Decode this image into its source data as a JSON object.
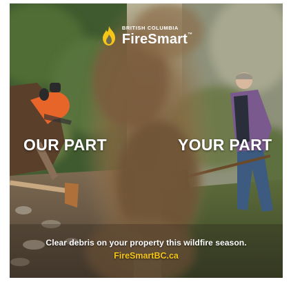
{
  "logo": {
    "small_text": "BRITISH COLUMBIA",
    "big_text": "FireSmart",
    "trademark": "™"
  },
  "headline_left": "OUR PART",
  "headline_right": "YOUR PART",
  "tagline": "Clear debris on your property this wildfire season.",
  "url": "FireSmartBC.ca",
  "colors": {
    "accent_yellow": "#f5c518",
    "text_white": "#ffffff",
    "dust_brown": "#8a6a45",
    "helmet_orange": "#e8652a"
  }
}
